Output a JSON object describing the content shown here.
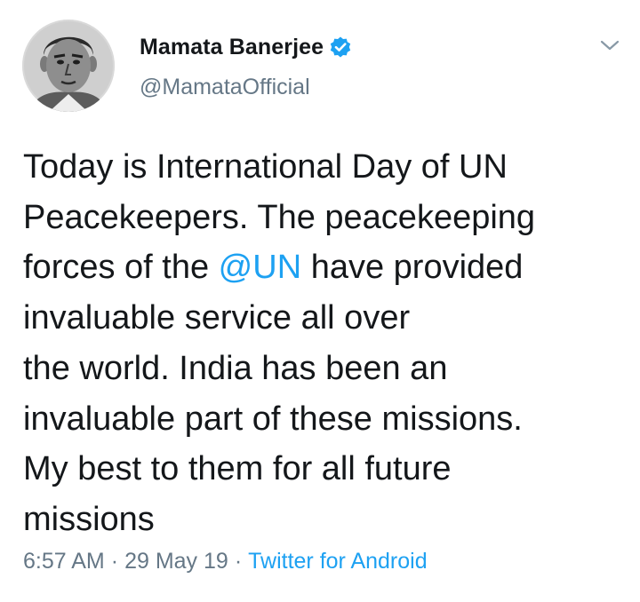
{
  "author": {
    "display_name": "Mamata Banerjee",
    "handle": "@MamataOfficial",
    "verified": true,
    "avatar_icon": "portrait-avatar"
  },
  "tweet": {
    "lines": [
      {
        "before": "Today is International Day of UN",
        "mention": "",
        "after": ""
      },
      {
        "before": "Peacekeepers. The peacekeeping",
        "mention": "",
        "after": ""
      },
      {
        "before": "forces of the ",
        "mention": "@UN",
        "after": " have provided"
      },
      {
        "before": "invaluable service all over",
        "mention": "",
        "after": ""
      },
      {
        "before": "the world. India has been an",
        "mention": "",
        "after": ""
      },
      {
        "before": "invaluable part of these missions.",
        "mention": "",
        "after": ""
      },
      {
        "before": "My best to them for all future",
        "mention": "",
        "after": ""
      },
      {
        "before": "missions",
        "mention": "",
        "after": ""
      }
    ]
  },
  "meta": {
    "time": "6:57 AM",
    "separator": "·",
    "date": "29 May 19",
    "source": "Twitter for Android"
  },
  "colors": {
    "link": "#1da1f2",
    "secondary_text": "#657786",
    "primary_text": "#14171a"
  },
  "icons": {
    "verified": "verified-badge-icon",
    "menu": "chevron-down-icon"
  }
}
